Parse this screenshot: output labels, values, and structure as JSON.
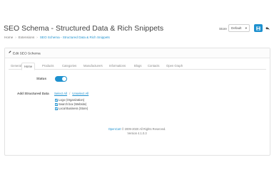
{
  "page": {
    "title": "SEO Schema - Structured Data & Rich Snippets",
    "breadcrumb": [
      "Home",
      "Extensions",
      "SEO Schema - Structured Data & Rich Snippets"
    ]
  },
  "toolbar": {
    "store_label": "Store",
    "store_value": "Default",
    "save_icon": "save-icon",
    "back_icon": "reply-icon"
  },
  "panel": {
    "heading": "Edit SEO Schema",
    "tabs": [
      "General",
      "Home",
      "Products",
      "Categories",
      "Manufacturers",
      "Informations",
      "Blogs",
      "Contacts",
      "Open Graph"
    ],
    "active_tab": "Home"
  },
  "form": {
    "status_label": "Status",
    "status_on": true,
    "add_structured_label": "Add Structured Data",
    "select_all": "Select All",
    "unselect_all": "Unselect All",
    "options": [
      {
        "label": "Logo (Organization)",
        "checked": true
      },
      {
        "label": "Search box (Website)",
        "checked": true
      },
      {
        "label": "Local Business (Store)",
        "checked": true
      }
    ]
  },
  "footer": {
    "brand": "OpenCart",
    "copyright": "© 2009-2020 All Rights Reserved.",
    "version": "Version 4.1.0.3"
  },
  "colors": {
    "accent": "#1e91cf"
  }
}
